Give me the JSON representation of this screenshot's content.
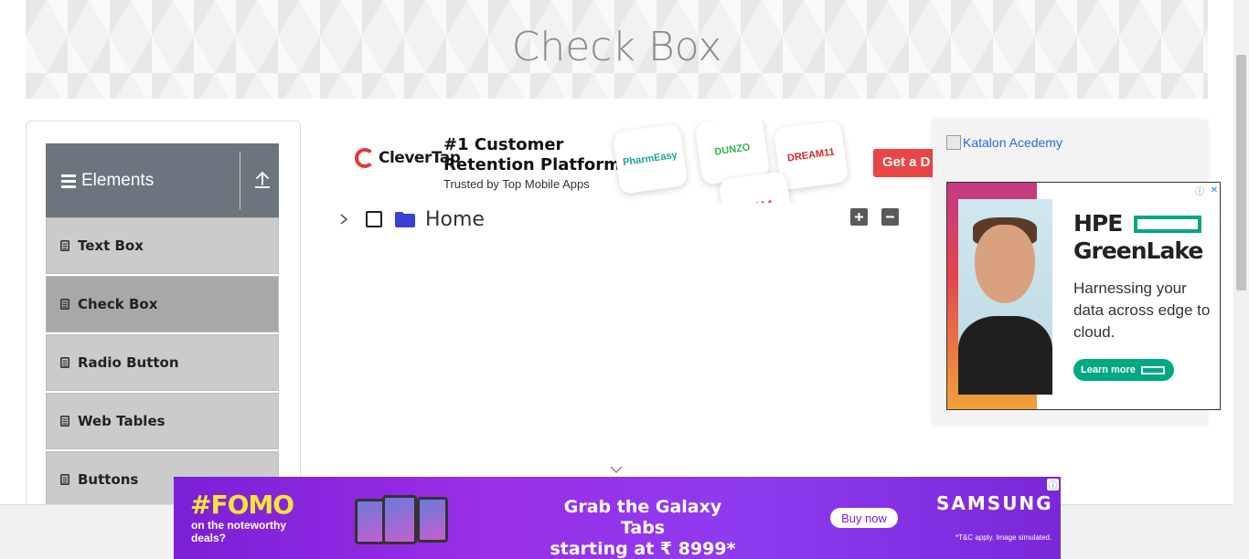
{
  "page": {
    "title": "Check Box"
  },
  "sidebar": {
    "group_title": "Elements",
    "items": [
      {
        "label": "Text Box"
      },
      {
        "label": "Check Box"
      },
      {
        "label": "Radio Button"
      },
      {
        "label": "Web Tables"
      },
      {
        "label": "Buttons"
      }
    ]
  },
  "tree": {
    "root_label": "Home"
  },
  "ads": {
    "top": {
      "brand": "CleverTap",
      "headline_1": "#1 Customer",
      "headline_2": "Retention Platform",
      "sub": "Trusted by Top Mobile Apps",
      "tiles": [
        "PharmEasy",
        "DUNZO",
        "DREAM11",
        "NYKAA"
      ],
      "cta": "Get a D"
    },
    "right": {
      "image_alt": "Katalon Acedemy",
      "brand_1": "HPE",
      "brand_2": "GreenLake",
      "tagline": "Harnessing your data across edge to cloud.",
      "cta": "Learn more"
    },
    "bottom": {
      "fomo": "#FOMO",
      "fomo_sub": "on the noteworthy deals?",
      "headline_1": "Grab the Galaxy Tabs",
      "headline_2": "starting at ₹ 8999*",
      "cta": "Buy now",
      "brand": "SAMSUNG",
      "disclaimer": "*T&C apply. Image simulated."
    }
  },
  "colors": {
    "accent_group": "#6c757d",
    "folder": "#3b3fd4",
    "hpe_green": "#01a982",
    "samsung_purple": "#7b1fd6"
  }
}
